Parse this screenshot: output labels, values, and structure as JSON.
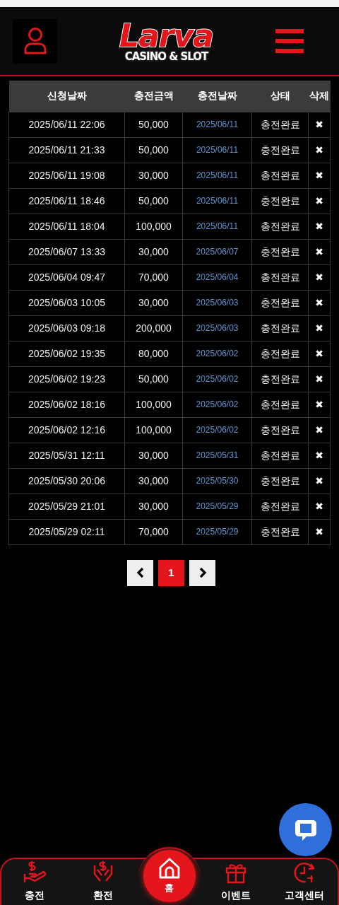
{
  "header": {
    "logo_title": "Larva",
    "logo_subtitle": "CASINO & SLOT"
  },
  "table": {
    "columns": [
      "신청날짜",
      "충전금액",
      "충전날짜",
      "상태",
      "삭제"
    ],
    "rows": [
      [
        "2025/06/11 22:06",
        "50,000",
        "2025/06/11",
        "충전완료",
        "✖"
      ],
      [
        "2025/06/11 21:33",
        "50,000",
        "2025/06/11",
        "충전완료",
        "✖"
      ],
      [
        "2025/06/11 19:08",
        "30,000",
        "2025/06/11",
        "충전완료",
        "✖"
      ],
      [
        "2025/06/11 18:46",
        "50,000",
        "2025/06/11",
        "충전완료",
        "✖"
      ],
      [
        "2025/06/11 18:04",
        "100,000",
        "2025/06/11",
        "충전완료",
        "✖"
      ],
      [
        "2025/06/07 13:33",
        "30,000",
        "2025/06/07",
        "충전완료",
        "✖"
      ],
      [
        "2025/06/04 09:47",
        "70,000",
        "2025/06/04",
        "충전완료",
        "✖"
      ],
      [
        "2025/06/03 10:05",
        "30,000",
        "2025/06/03",
        "충전완료",
        "✖"
      ],
      [
        "2025/06/03 09:18",
        "200,000",
        "2025/06/03",
        "충전완료",
        "✖"
      ],
      [
        "2025/06/02 19:35",
        "80,000",
        "2025/06/02",
        "충전완료",
        "✖"
      ],
      [
        "2025/06/02 19:23",
        "50,000",
        "2025/06/02",
        "충전완료",
        "✖"
      ],
      [
        "2025/06/02 18:16",
        "100,000",
        "2025/06/02",
        "충전완료",
        "✖"
      ],
      [
        "2025/06/02 12:16",
        "100,000",
        "2025/06/02",
        "충전완료",
        "✖"
      ],
      [
        "2025/05/31 12:11",
        "30,000",
        "2025/05/31",
        "충전완료",
        "✖"
      ],
      [
        "2025/05/30 20:06",
        "30,000",
        "2025/05/30",
        "충전완료",
        "✖"
      ],
      [
        "2025/05/29 21:01",
        "30,000",
        "2025/05/29",
        "충전완료",
        "✖"
      ],
      [
        "2025/05/29 02:11",
        "70,000",
        "2025/05/29",
        "충전완료",
        "✖"
      ]
    ]
  },
  "pagination": {
    "pages": [
      {
        "label": "1",
        "selected": true
      }
    ]
  },
  "bottom_nav": [
    {
      "label": "충전",
      "selected": false
    },
    {
      "label": "환전",
      "selected": false
    },
    {
      "label": "홈",
      "selected": true
    },
    {
      "label": "이벤트",
      "selected": false
    },
    {
      "label": "고객센터",
      "selected": false
    }
  ]
}
